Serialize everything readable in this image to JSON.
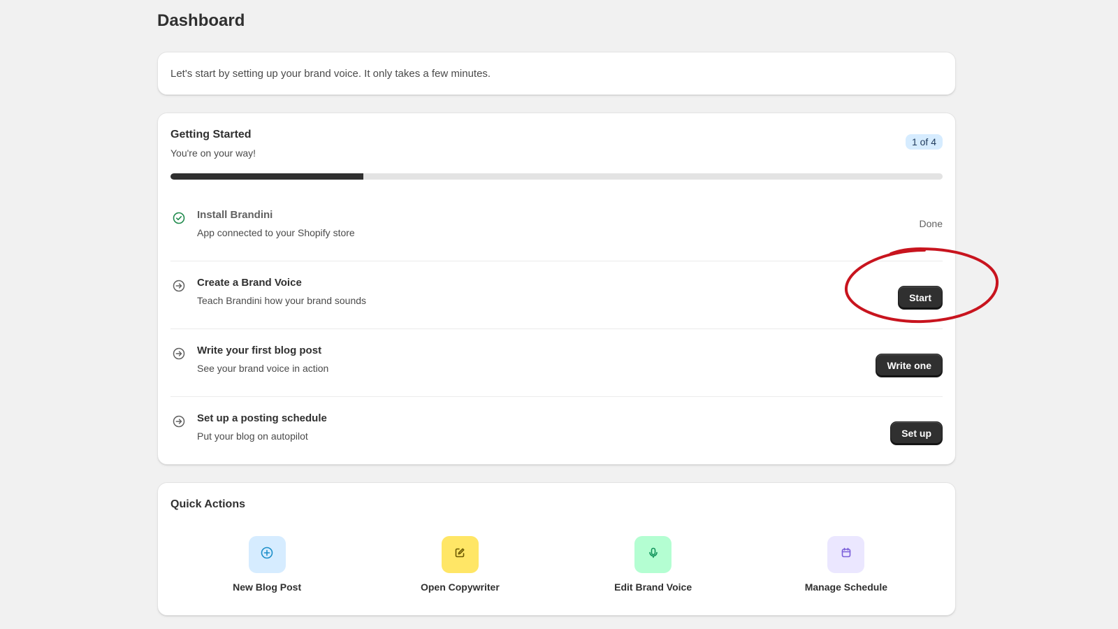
{
  "page": {
    "title": "Dashboard"
  },
  "banner": {
    "text": "Let's start by setting up your brand voice. It only takes a few minutes."
  },
  "getting_started": {
    "title": "Getting Started",
    "subtitle": "You're on your way!",
    "badge": "1 of 4",
    "progress_fraction": 0.25,
    "tasks": [
      {
        "title": "Install Brandini",
        "description": "App connected to your Shopify store",
        "status": "Done",
        "icon": "check-circle-icon",
        "completed": true
      },
      {
        "title": "Create a Brand Voice",
        "description": "Teach Brandini how your brand sounds",
        "action": "Start",
        "icon": "arrow-circle-icon",
        "completed": false
      },
      {
        "title": "Write your first blog post",
        "description": "See your brand voice in action",
        "action": "Write one",
        "icon": "arrow-circle-icon",
        "completed": false
      },
      {
        "title": "Set up a posting schedule",
        "description": "Put your blog on autopilot",
        "action": "Set up",
        "icon": "arrow-circle-icon",
        "completed": false
      }
    ]
  },
  "quick_actions": {
    "title": "Quick Actions",
    "items": [
      {
        "label": "New Blog Post",
        "icon": "plus-circle-icon",
        "bg": "#d6ecff",
        "fg": "#1d8fc9"
      },
      {
        "label": "Open Copywriter",
        "icon": "edit-icon",
        "bg": "#ffe666",
        "fg": "#6b5800"
      },
      {
        "label": "Edit Brand Voice",
        "icon": "microphone-icon",
        "bg": "#b4fed2",
        "fg": "#10935a"
      },
      {
        "label": "Manage Schedule",
        "icon": "calendar-icon",
        "bg": "#ebe7ff",
        "fg": "#7b5fd9"
      }
    ]
  },
  "colors": {
    "annotation": "#c8141e",
    "success": "#1f8a4c",
    "primary_button": "#303030"
  }
}
